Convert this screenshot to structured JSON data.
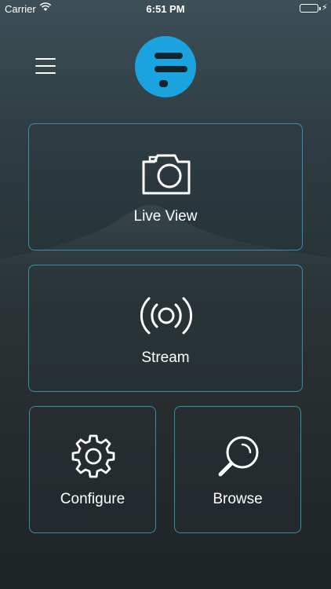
{
  "status_bar": {
    "carrier": "Carrier",
    "time": "6:51 PM",
    "battery_color": "#4cd964"
  },
  "header": {
    "menu_icon": "hamburger-menu-icon",
    "logo_color": "#1ba3e0"
  },
  "tiles": [
    {
      "label": "Live View",
      "icon": "camera-icon"
    },
    {
      "label": "Stream",
      "icon": "broadcast-icon"
    },
    {
      "label": "Configure",
      "icon": "gear-icon"
    },
    {
      "label": "Browse",
      "icon": "magnifier-icon"
    }
  ],
  "theme": {
    "tile_border": "#48aacd",
    "text": "#ffffff"
  }
}
